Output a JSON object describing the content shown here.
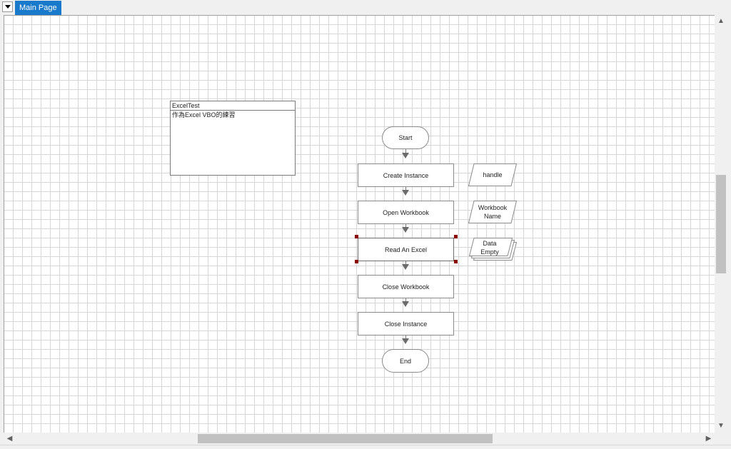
{
  "tabs": {
    "dropdown_icon": "triangle-down-icon",
    "main_page": "Main Page"
  },
  "note": {
    "title": "ExcelTest",
    "body": "作為Excel VBO的練習"
  },
  "flow": {
    "start": "Start",
    "end": "End",
    "steps": [
      "Create Instance",
      "Open Workbook",
      "Read An Excel",
      "Close Workbook",
      "Close Instance"
    ],
    "data_items": [
      "handle",
      "Workbook\nName",
      "Data\nEmpty"
    ]
  },
  "scroll": {
    "up_icon": "▲",
    "down_icon": "▼",
    "left_icon": "◀",
    "right_icon": "▶"
  },
  "colors": {
    "tab_active": "#1979ca",
    "selection_handle": "#8b0000",
    "grid": "#d6d6d6"
  }
}
